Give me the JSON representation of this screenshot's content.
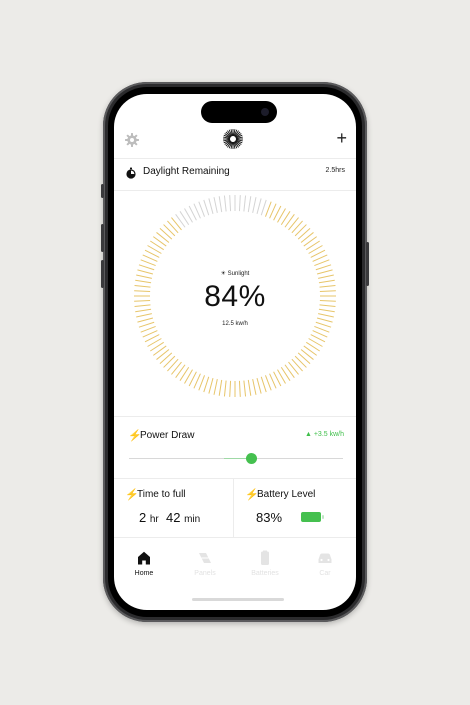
{
  "header": {
    "settings_icon": "gear-icon",
    "logo_icon": "sun-logo-icon",
    "add_label": "+"
  },
  "daylight": {
    "label": "Daylight Remaining",
    "value": "2.5hrs"
  },
  "gauge": {
    "sun_label": "☀ Sunlight",
    "percent_label": "84%",
    "percent": 84,
    "power_label": "12.5 kw/h",
    "active_color": "#e7c56a",
    "inactive_color": "#d4d4d4"
  },
  "power_draw": {
    "label": "Power Draw",
    "delta": "▲ +3.5 kw/h",
    "level": 0.52
  },
  "time_to_full": {
    "label": "Time to full",
    "hours": "2",
    "hours_unit": "hr",
    "minutes": "42",
    "minutes_unit": "min"
  },
  "battery": {
    "label": "Battery Level",
    "value": "83%",
    "level": 0.83
  },
  "tabs": [
    {
      "label": "Home",
      "icon": "home-icon",
      "active": true
    },
    {
      "label": "Panels",
      "icon": "panels-icon",
      "active": false
    },
    {
      "label": "Batteries",
      "icon": "battery-icon",
      "active": false
    },
    {
      "label": "Car",
      "icon": "car-icon",
      "active": false
    }
  ],
  "colors": {
    "accent_green": "#45c04f",
    "sun_yellow": "#e7c56a"
  }
}
